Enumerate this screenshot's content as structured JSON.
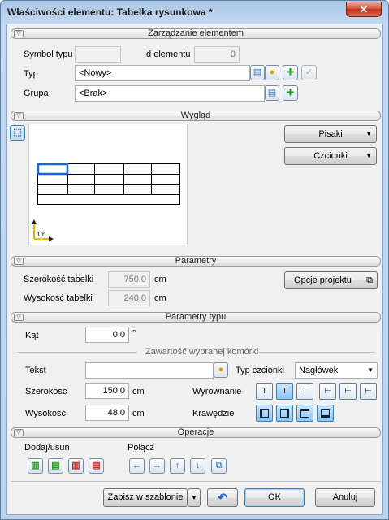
{
  "window": {
    "title": "Właściwości elementu: Tabelka rysunkowa *",
    "close_glyph": "✕"
  },
  "sections": {
    "zarzadzanie": "Zarządzanie elementem",
    "wyglad": "Wygląd",
    "parametry": "Parametry",
    "parametry_typu": "Parametry typu",
    "operacje": "Operacje"
  },
  "zarzadzanie": {
    "symbol_label": "Symbol typu",
    "symbol_value": "",
    "id_label": "Id elementu",
    "id_value": "0",
    "typ_label": "Typ",
    "typ_value": "<Nowy>",
    "grupa_label": "Grupa",
    "grupa_value": "<Brak>"
  },
  "wyglad": {
    "pisaki": "Pisaki",
    "czcionki": "Czcionki",
    "scale_label": "1m"
  },
  "parametry": {
    "szerokosc_label": "Szerokość tabelki",
    "szerokosc_value": "750.0",
    "szerokosc_unit": "cm",
    "wysokosc_label": "Wysokość tabelki",
    "wysokosc_value": "240.0",
    "wysokosc_unit": "cm",
    "opcje_projektu": "Opcje projektu"
  },
  "parametry_typu": {
    "kat_label": "Kąt",
    "kat_value": "0.0",
    "kat_unit": "°",
    "zawartosc_title": "Zawartość wybranej komórki",
    "tekst_label": "Tekst",
    "tekst_value": "",
    "typ_czcionki_label": "Typ czcionki",
    "typ_czcionki_value": "Nagłówek",
    "szerokosc_label": "Szerokość",
    "szerokosc_value": "150.0",
    "szerokosc_unit": "cm",
    "wysokosc_label": "Wysokość",
    "wysokosc_value": "48.0",
    "wysokosc_unit": "cm",
    "wyrownanie_label": "Wyrównanie",
    "krawedzie_label": "Krawędzie",
    "align_buttons": [
      "T",
      "T",
      "T",
      "⊢",
      "⊢",
      "⊢"
    ]
  },
  "operacje": {
    "dodaj_usun_label": "Dodaj/usuń",
    "polacz_label": "Połącz"
  },
  "footer": {
    "zapisz": "Zapisz w szablonie",
    "ok": "OK",
    "anuluj": "Anuluj"
  }
}
